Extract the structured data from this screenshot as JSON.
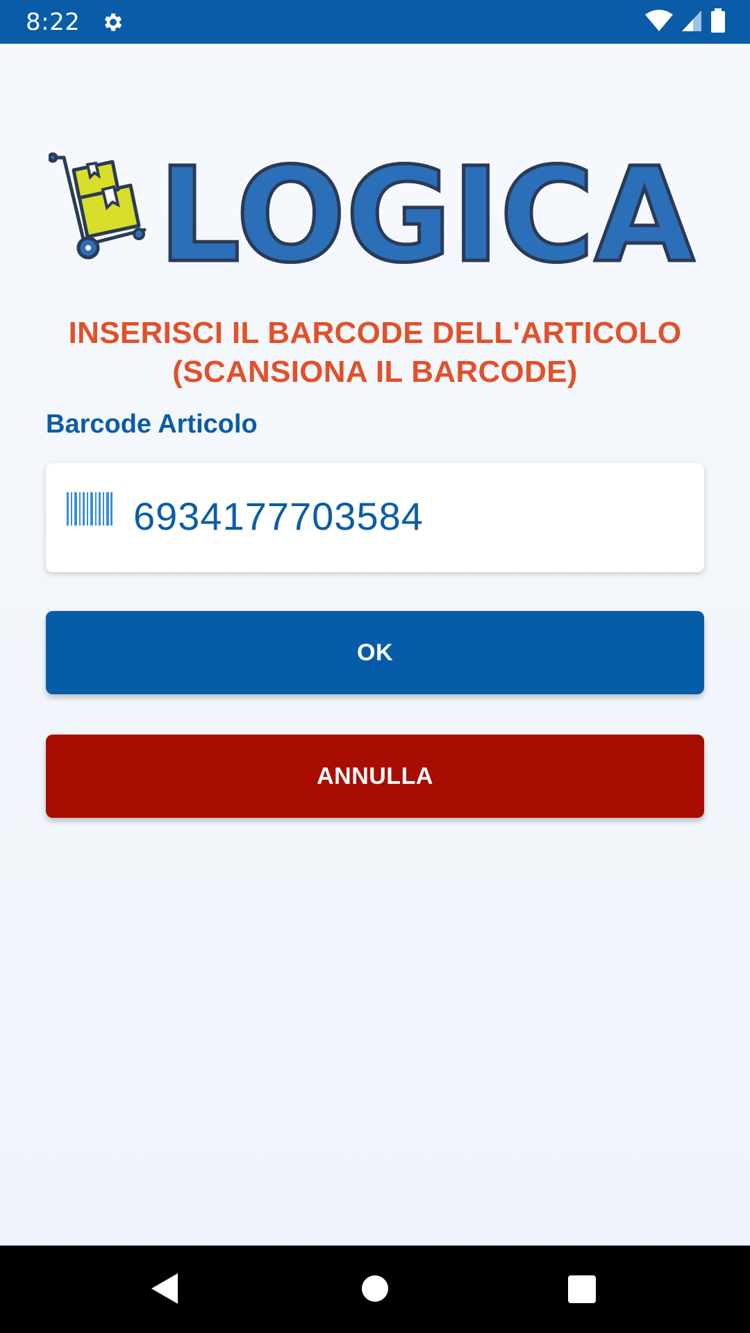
{
  "status_bar": {
    "time": "8:22",
    "icons": [
      "gear-icon",
      "wifi-icon",
      "signal-icon",
      "battery-icon"
    ]
  },
  "logo": {
    "text": "LOGICA",
    "icon": "hand-truck-boxes-icon"
  },
  "instruction": {
    "line1": "INSERISCI IL BARCODE DELL'ARTICOLO",
    "line2": "(SCANSIONA IL BARCODE)"
  },
  "barcode_field": {
    "label": "Barcode Articolo",
    "value": "6934177703584",
    "icon": "barcode-icon"
  },
  "buttons": {
    "ok_label": "OK",
    "cancel_label": "ANNULLA"
  },
  "nav_bar": {
    "icons": [
      "back-icon",
      "home-icon",
      "recent-apps-icon"
    ]
  },
  "colors": {
    "primary_blue": "#075ca8",
    "cancel_red": "#a80d02",
    "heading_orange": "#e2502a",
    "logo_yellow": "#d9de2a"
  }
}
